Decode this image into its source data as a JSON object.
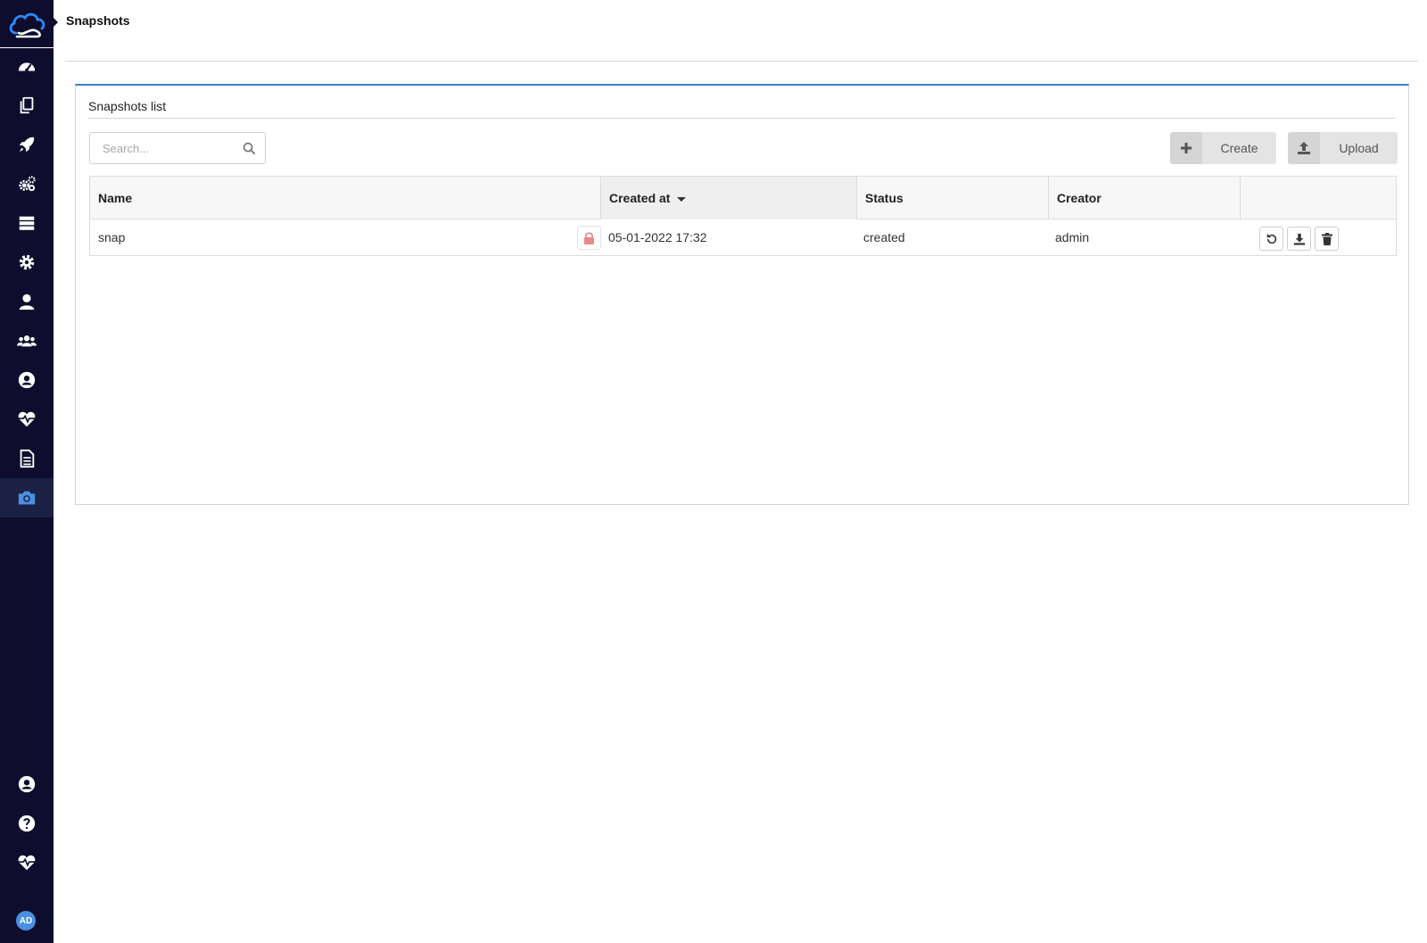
{
  "header": {
    "title": "Snapshots"
  },
  "sidebar": {
    "items": [
      {
        "icon": "dashboard-icon"
      },
      {
        "icon": "copy-icon"
      },
      {
        "icon": "rocket-icon"
      },
      {
        "icon": "cogs-icon"
      },
      {
        "icon": "server-icon"
      },
      {
        "icon": "gear-icon"
      },
      {
        "icon": "user-icon"
      },
      {
        "icon": "users-icon"
      },
      {
        "icon": "user-circle-icon"
      },
      {
        "icon": "heartbeat-icon"
      },
      {
        "icon": "document-icon"
      },
      {
        "icon": "camera-icon",
        "active": true
      }
    ],
    "bottom": [
      {
        "icon": "user-circle-icon"
      },
      {
        "icon": "help-icon"
      },
      {
        "icon": "heartbeat-icon"
      }
    ],
    "avatar_initials": "AD",
    "colors": {
      "background": "#0e0d2e",
      "active": "#1b2144",
      "icon": "#ffffff",
      "active_icon": "#4a90e2"
    }
  },
  "panel": {
    "title": "Snapshots list",
    "accent": "#3f7fc6",
    "search": {
      "placeholder": "Search...",
      "value": ""
    },
    "buttons": {
      "create": "Create",
      "upload": "Upload"
    },
    "table": {
      "columns": {
        "name": "Name",
        "created_at": "Created at",
        "status": "Status",
        "creator": "Creator"
      },
      "rows": [
        {
          "name": "snap",
          "created_at": "05-01-2022 17:32",
          "status": "created",
          "creator": "admin",
          "locked": true
        }
      ]
    }
  }
}
